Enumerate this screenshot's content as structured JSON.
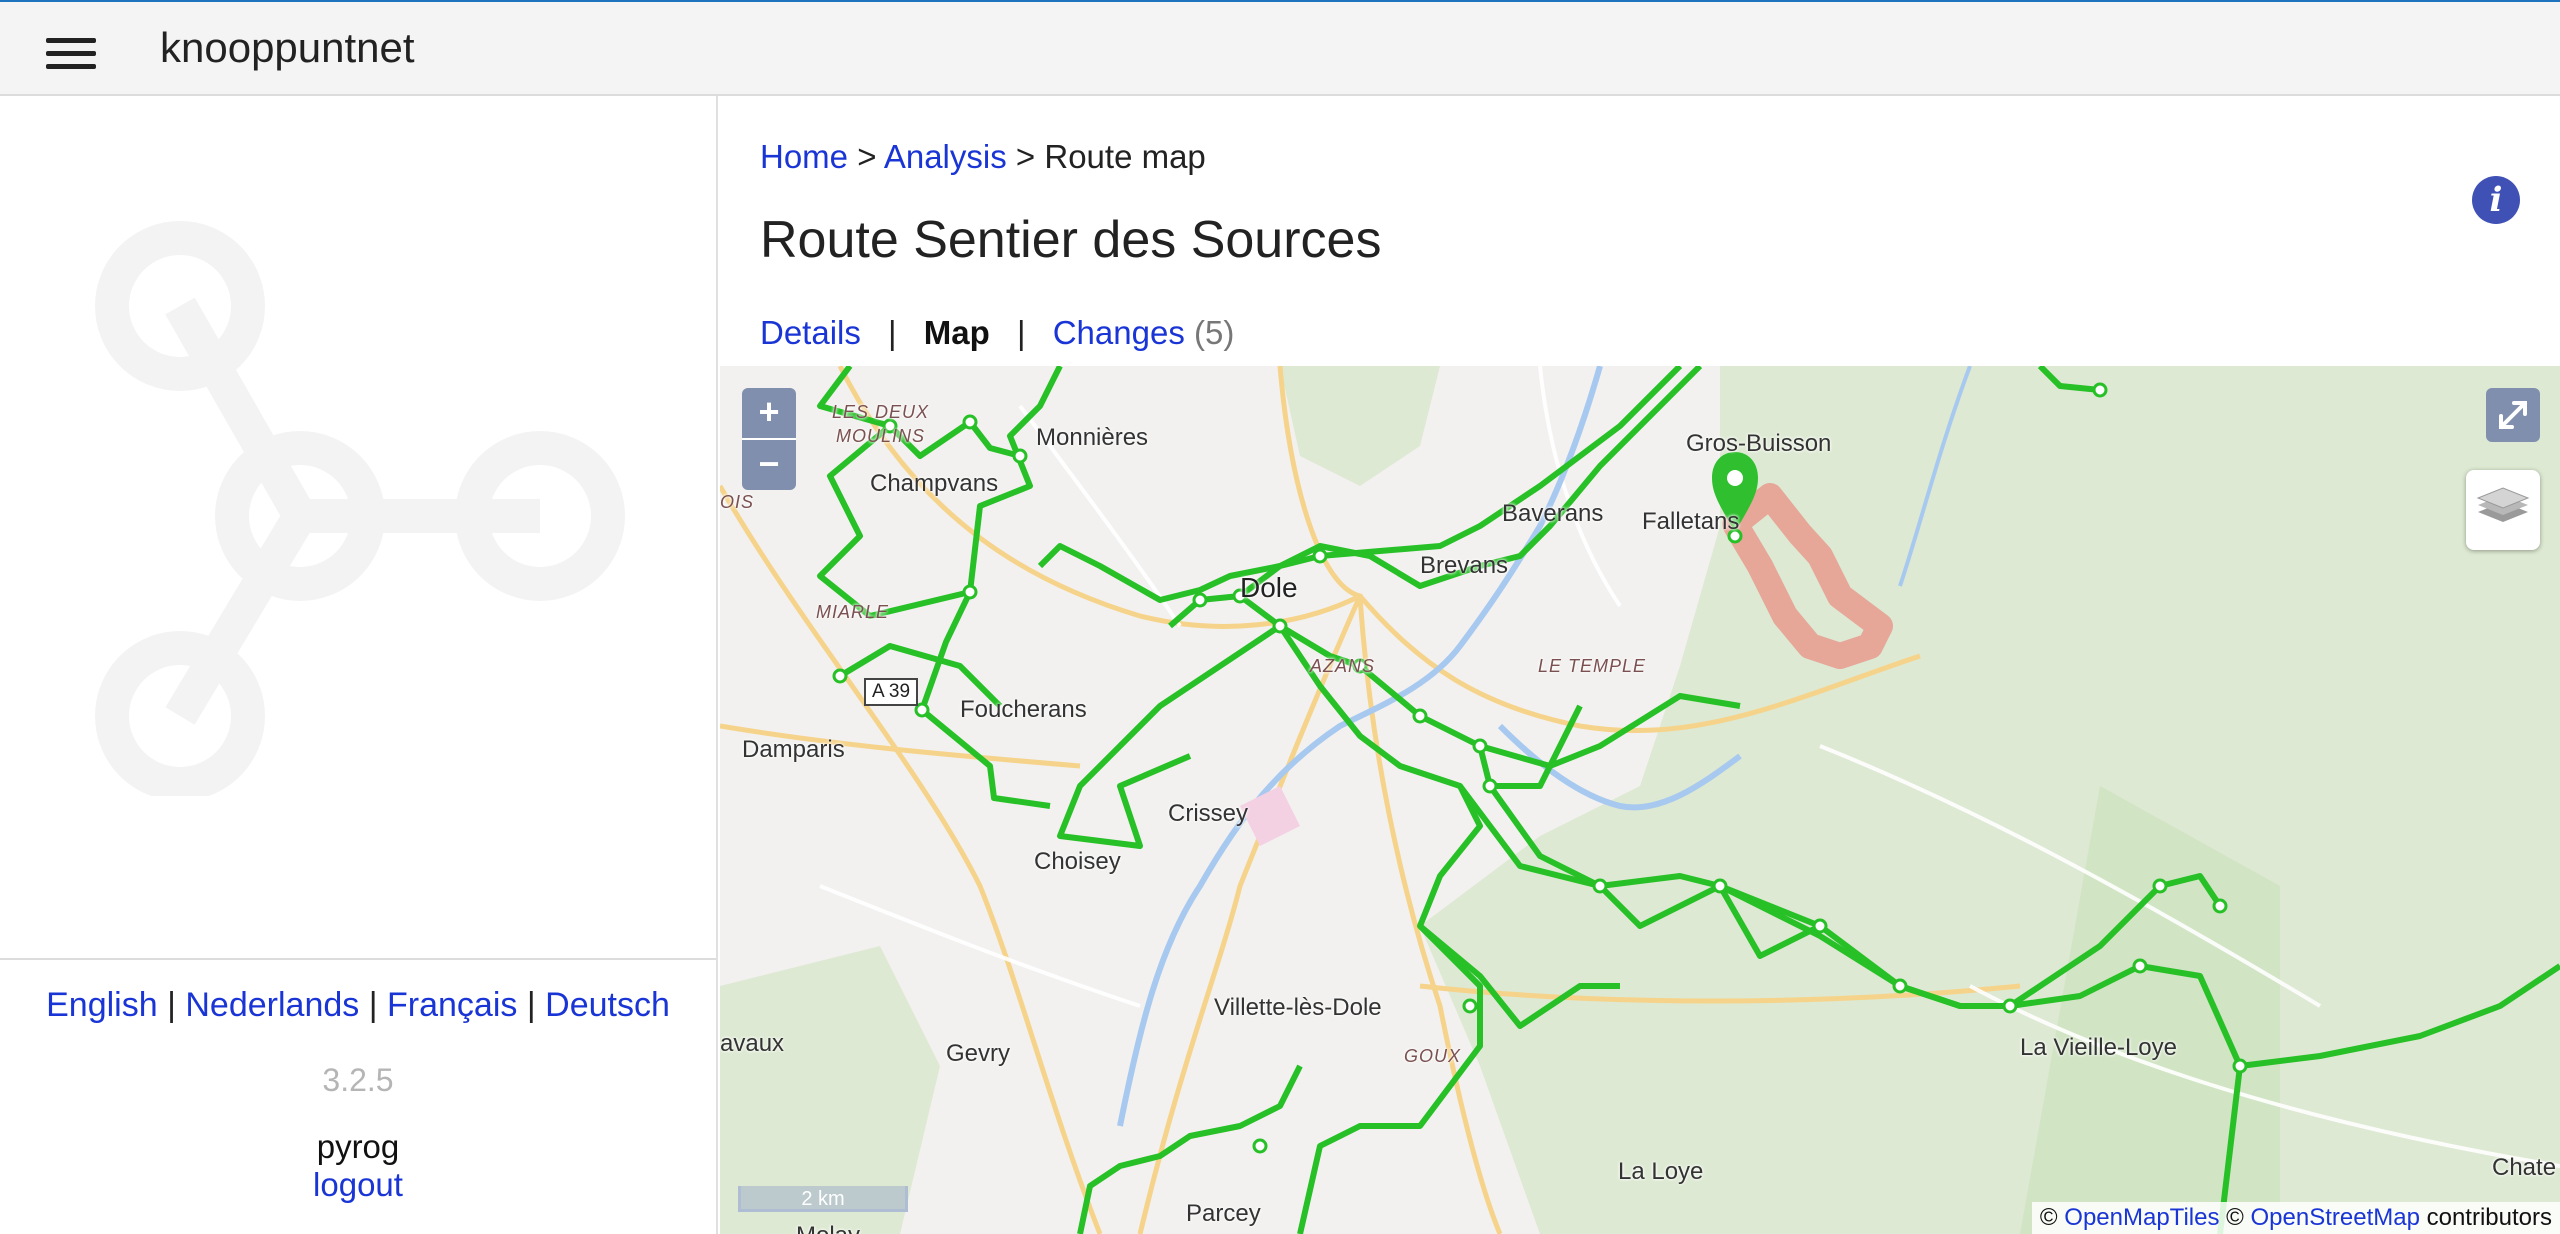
{
  "app": {
    "title": "knooppuntnet"
  },
  "breadcrumb": {
    "home": "Home",
    "analysis": "Analysis",
    "current": "Route map",
    "separator": ">"
  },
  "page": {
    "title": "Route Sentier des Sources"
  },
  "tabs": {
    "details": "Details",
    "map": "Map",
    "changes": "Changes",
    "changes_count": "(5)",
    "separator": "|"
  },
  "sidebar": {
    "languages": [
      "English",
      "Nederlands",
      "Français",
      "Deutsch"
    ],
    "language_separator": "|",
    "version": "3.2.5",
    "user": "pyrog",
    "logout": "logout"
  },
  "map": {
    "zoom_in": "+",
    "zoom_out": "−",
    "scale": "2 km",
    "attribution": {
      "copy1": "©",
      "openmaptiles": "OpenMapTiles",
      "copy2": "©",
      "openstreetmap": "OpenStreetMap",
      "contributors": "contributors"
    },
    "labels": {
      "les_deux_moulins_1": "LES DEUX",
      "les_deux_moulins_2": "MOULINS",
      "monnieres": "Monnières",
      "champvans": "Champvans",
      "ois": "OIS",
      "miarle": "MIARLE",
      "a39": "A 39",
      "foucherans": "Foucherans",
      "damparis": "Damparis",
      "dole": "Dole",
      "azans": "AZANS",
      "brevans": "Brevans",
      "baverans": "Baverans",
      "gros_buisson": "Gros-Buisson",
      "falletans": "Falletans",
      "le_temple": "LE TEMPLE",
      "crissey": "Crissey",
      "choisey": "Choisey",
      "villette": "Villette-lès-Dole",
      "goux": "GOUX",
      "gevry": "Gevry",
      "avaux": "avaux",
      "la_loye": "La Loye",
      "la_vieille_loye": "La Vieille-Loye",
      "parcey": "Parcey",
      "molay": "Molay",
      "chate": "Chate"
    },
    "colors": {
      "route_network": "#27c027",
      "highlight_route": "#e89a8e",
      "marker": "#2fbf2f",
      "water": "#9fc6ef",
      "forest": "#d6e6cc"
    }
  }
}
